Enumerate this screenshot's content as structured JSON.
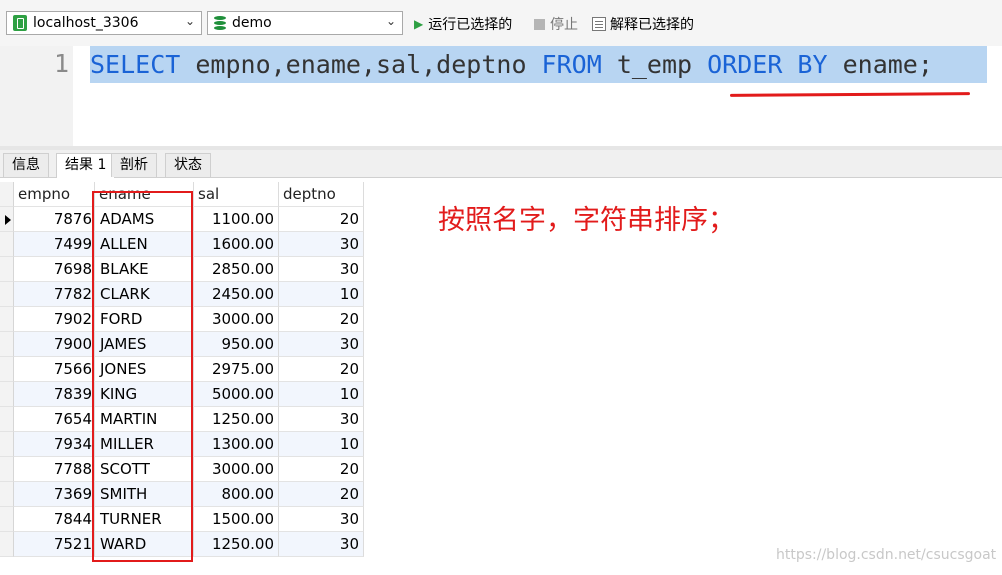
{
  "toolbar": {
    "connection": "localhost_3306",
    "database": "demo",
    "run_label": "运行已选择的",
    "stop_label": "停止",
    "explain_label": "解释已选择的"
  },
  "editor": {
    "line_number": "1",
    "tokens": [
      {
        "text": "SELECT",
        "kw": true
      },
      {
        "text": " empno,ename,sal,deptno ",
        "kw": false
      },
      {
        "text": "FROM",
        "kw": true
      },
      {
        "text": " t_emp ",
        "kw": false
      },
      {
        "text": "ORDER BY",
        "kw": true
      },
      {
        "text": " ename;",
        "kw": false
      }
    ]
  },
  "tabs": [
    "信息",
    "结果 1",
    "剖析",
    "状态"
  ],
  "active_tab": 1,
  "grid": {
    "columns": [
      "empno",
      "ename",
      "sal",
      "deptno"
    ],
    "rows": [
      [
        "7876",
        "ADAMS",
        "1100.00",
        "20"
      ],
      [
        "7499",
        "ALLEN",
        "1600.00",
        "30"
      ],
      [
        "7698",
        "BLAKE",
        "2850.00",
        "30"
      ],
      [
        "7782",
        "CLARK",
        "2450.00",
        "10"
      ],
      [
        "7902",
        "FORD",
        "3000.00",
        "20"
      ],
      [
        "7900",
        "JAMES",
        "950.00",
        "30"
      ],
      [
        "7566",
        "JONES",
        "2975.00",
        "20"
      ],
      [
        "7839",
        "KING",
        "5000.00",
        "10"
      ],
      [
        "7654",
        "MARTIN",
        "1250.00",
        "30"
      ],
      [
        "7934",
        "MILLER",
        "1300.00",
        "10"
      ],
      [
        "7788",
        "SCOTT",
        "3000.00",
        "20"
      ],
      [
        "7369",
        "SMITH",
        "800.00",
        "20"
      ],
      [
        "7844",
        "TURNER",
        "1500.00",
        "30"
      ],
      [
        "7521",
        "WARD",
        "1250.00",
        "30"
      ]
    ]
  },
  "annotation": "按照名字，字符串排序；",
  "watermark": "https://blog.csdn.net/csucsgoat",
  "colors": {
    "keyword": "#1a63d6",
    "annotation": "#e21b1b",
    "selection": "#b8d5f2"
  }
}
